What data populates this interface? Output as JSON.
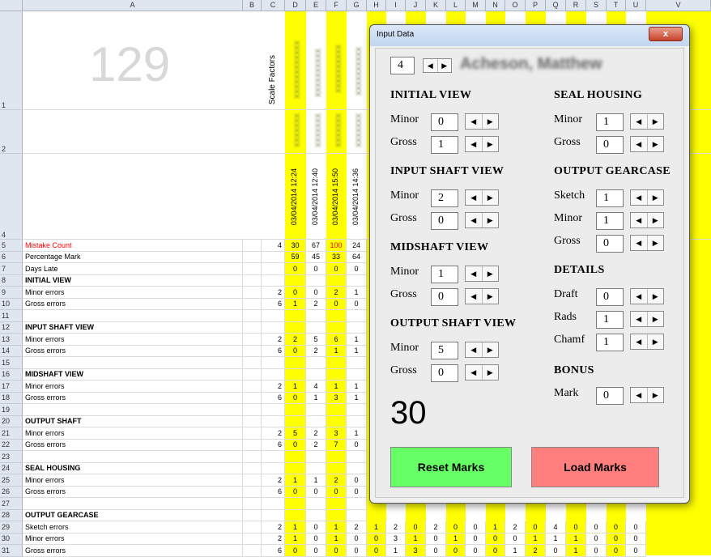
{
  "sheet": {
    "col_headers": [
      "A",
      "B",
      "C",
      "D",
      "E",
      "F",
      "G",
      "H",
      "I",
      "J",
      "K",
      "L",
      "M",
      "N",
      "O",
      "P",
      "Q",
      "R",
      "S",
      "T",
      "U",
      "V"
    ],
    "big_number": "129",
    "scale_factors_label": "Scale Factors",
    "dates": [
      "03/04/2014 12:24",
      "03/04/2014 12:40",
      "03/04/2014 15:50",
      "03/04/2014 14:36"
    ],
    "rows": [
      {
        "n": "5",
        "label": "Mistake Count",
        "c": "4",
        "d": [
          "30",
          "67",
          "100",
          "24"
        ]
      },
      {
        "n": "6",
        "label": "Percentage Mark",
        "c": "",
        "d": [
          "59",
          "45",
          "33",
          "64"
        ]
      },
      {
        "n": "7",
        "label": "Days Late",
        "c": "",
        "d": [
          "0",
          "0",
          "0",
          "0"
        ]
      },
      {
        "n": "8",
        "label": "INITIAL VIEW",
        "c": "",
        "d": [
          "",
          "",
          "",
          ""
        ]
      },
      {
        "n": "9",
        "label": "Minor errors",
        "c": "2",
        "d": [
          "0",
          "0",
          "2",
          "1"
        ]
      },
      {
        "n": "10",
        "label": "Gross errors",
        "c": "6",
        "d": [
          "1",
          "2",
          "0",
          "0"
        ]
      },
      {
        "n": "11",
        "label": "",
        "c": "",
        "d": [
          "",
          "",
          "",
          ""
        ]
      },
      {
        "n": "12",
        "label": "INPUT SHAFT VIEW",
        "c": "",
        "d": [
          "",
          "",
          "",
          ""
        ]
      },
      {
        "n": "13",
        "label": "Minor errors",
        "c": "2",
        "d": [
          "2",
          "5",
          "6",
          "1"
        ]
      },
      {
        "n": "14",
        "label": "Gross errors",
        "c": "6",
        "d": [
          "0",
          "2",
          "1",
          "1"
        ]
      },
      {
        "n": "15",
        "label": "",
        "c": "",
        "d": [
          "",
          "",
          "",
          ""
        ]
      },
      {
        "n": "16",
        "label": "MIDSHAFT VIEW",
        "c": "",
        "d": [
          "",
          "",
          "",
          ""
        ]
      },
      {
        "n": "17",
        "label": "Minor errors",
        "c": "2",
        "d": [
          "1",
          "4",
          "1",
          "1"
        ]
      },
      {
        "n": "18",
        "label": "Gross errors",
        "c": "6",
        "d": [
          "0",
          "1",
          "3",
          "1"
        ]
      },
      {
        "n": "19",
        "label": "",
        "c": "",
        "d": [
          "",
          "",
          "",
          ""
        ]
      },
      {
        "n": "20",
        "label": "OUTPUT SHAFT",
        "c": "",
        "d": [
          "",
          "",
          "",
          ""
        ]
      },
      {
        "n": "21",
        "label": "Minor errors",
        "c": "2",
        "d": [
          "5",
          "2",
          "3",
          "1"
        ]
      },
      {
        "n": "22",
        "label": "Gross errors",
        "c": "6",
        "d": [
          "0",
          "2",
          "7",
          "0"
        ]
      },
      {
        "n": "23",
        "label": "",
        "c": "",
        "d": [
          "",
          "",
          "",
          ""
        ]
      },
      {
        "n": "24",
        "label": "SEAL HOUSING",
        "c": "",
        "d": [
          "",
          "",
          "",
          ""
        ]
      },
      {
        "n": "25",
        "label": "Minor errors",
        "c": "2",
        "d": [
          "1",
          "1",
          "2",
          "0"
        ]
      },
      {
        "n": "26",
        "label": "Gross errors",
        "c": "6",
        "d": [
          "0",
          "0",
          "0",
          "0"
        ]
      },
      {
        "n": "27",
        "label": "",
        "c": "",
        "d": [
          "",
          "",
          "",
          ""
        ]
      },
      {
        "n": "28",
        "label": "OUTPUT GEARCASE",
        "c": "",
        "d": [
          "",
          "",
          "",
          ""
        ]
      },
      {
        "n": "29",
        "label": "Sketch errors",
        "c": "2",
        "d": [
          "1",
          "0",
          "1",
          "2"
        ]
      },
      {
        "n": "30",
        "label": "Minor errors",
        "c": "2",
        "d": [
          "1",
          "0",
          "1",
          "0"
        ]
      },
      {
        "n": "31",
        "label": "Gross errors",
        "c": "6",
        "d": [
          "0",
          "0",
          "0",
          "0"
        ]
      }
    ],
    "extra_rows": {
      "29": [
        "1",
        "2",
        "0",
        "2",
        "0",
        "0",
        "1",
        "2",
        "0",
        "4",
        "0",
        "0",
        "0",
        "0"
      ],
      "30": [
        "0",
        "3",
        "1",
        "0",
        "1",
        "0",
        "0",
        "0",
        "1",
        "1",
        "1",
        "0",
        "0",
        "0"
      ],
      "31": [
        "0",
        "1",
        "3",
        "0",
        "0",
        "0",
        "0",
        "1",
        "2",
        "0",
        "1",
        "0",
        "0",
        "0"
      ]
    }
  },
  "dialog": {
    "title": "Input Data",
    "close": "x",
    "record": "4",
    "student_name": "Acheson, Matthew",
    "total": "30",
    "sections": {
      "initial_view": {
        "title": "INITIAL VIEW",
        "minor_label": "Minor",
        "minor": "0",
        "gross_label": "Gross",
        "gross": "1"
      },
      "input_shaft_view": {
        "title": "INPUT SHAFT VIEW",
        "minor_label": "Minor",
        "minor": "2",
        "gross_label": "Gross",
        "gross": "0"
      },
      "midshaft_view": {
        "title": "MIDSHAFT VIEW",
        "minor_label": "Minor",
        "minor": "1",
        "gross_label": "Gross",
        "gross": "0"
      },
      "output_shaft_view": {
        "title": "OUTPUT SHAFT VIEW",
        "minor_label": "Minor",
        "minor": "5",
        "gross_label": "Gross",
        "gross": "0"
      },
      "seal_housing": {
        "title": "SEAL HOUSING",
        "minor_label": "Minor",
        "minor": "1",
        "gross_label": "Gross",
        "gross": "0"
      },
      "output_gearcase": {
        "title": "OUTPUT GEARCASE",
        "sketch_label": "Sketch",
        "sketch": "1",
        "minor_label": "Minor",
        "minor": "1",
        "gross_label": "Gross",
        "gross": "0"
      },
      "details": {
        "title": "DETAILS",
        "draft_label": "Draft",
        "draft": "0",
        "rads_label": "Rads",
        "rads": "1",
        "chamf_label": "Chamf",
        "chamf": "1"
      },
      "bonus": {
        "title": "BONUS",
        "mark_label": "Mark",
        "mark": "0"
      }
    },
    "reset_button": "Reset Marks",
    "load_button": "Load Marks",
    "colors": {
      "reset": "#66ff66",
      "load": "#ff7f7f",
      "highlight": "#ffff00",
      "mistake": "#ff0000"
    }
  }
}
